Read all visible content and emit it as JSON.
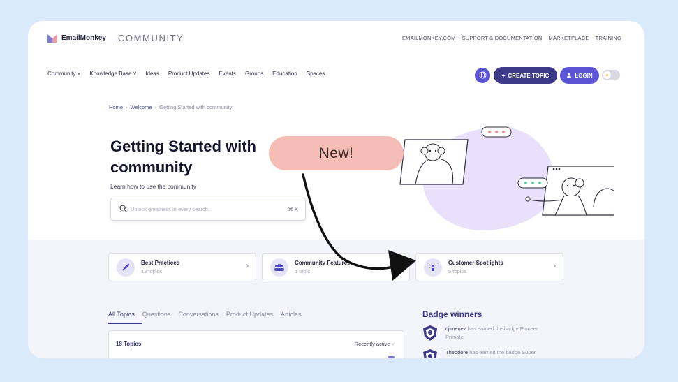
{
  "header": {
    "brand": "EmailMonkey",
    "community_word": "COMMUNITY",
    "top_links": [
      "EMAILMONKEY.COM",
      "SUPPORT & DOCUMENTATION",
      "MARKETPLACE",
      "TRAINING"
    ]
  },
  "nav": {
    "items": [
      "Community ˅",
      "Knowledge Base ˅",
      "Ideas",
      "Product Updates",
      "Events",
      "Groups",
      "Education",
      "Spaces"
    ],
    "create_label": "CREATE TOPIC",
    "login_label": "LOGIN"
  },
  "breadcrumb": {
    "home": "Home",
    "welcome": "Welcome",
    "current": "Getting Started with community"
  },
  "hero": {
    "title": "Getting Started with community",
    "subtitle": "Learn how to use the community",
    "search_placeholder": "Unlock greatness in every search...",
    "search_shortcut": "⌘ K"
  },
  "overlay": {
    "new_label": "New!"
  },
  "cards": [
    {
      "title": "Best Practices",
      "subtitle": "12 topics",
      "icon": "rocket-icon"
    },
    {
      "title": "Community Features",
      "subtitle": "1 topic",
      "icon": "people-icon"
    },
    {
      "title": "Customer Spotlights",
      "subtitle": "5 topics",
      "icon": "spotlight-icon"
    }
  ],
  "tabs": [
    "All Topics",
    "Questions",
    "Conversations",
    "Product Updates",
    "Articles"
  ],
  "topics": {
    "count_label": "18 Topics",
    "sort_label": "Recently active"
  },
  "badges": {
    "heading": "Badge winners",
    "items": [
      {
        "user": "cjimenez",
        "text": " has earned the badge Pioneer Primate"
      },
      {
        "user": "Theodore",
        "text": " has earned the badge Super"
      }
    ]
  },
  "colors": {
    "accent": "#3d3a8a",
    "primary": "#5b55d6",
    "pill": "#f6bdb6",
    "background": "#dbeafb"
  }
}
